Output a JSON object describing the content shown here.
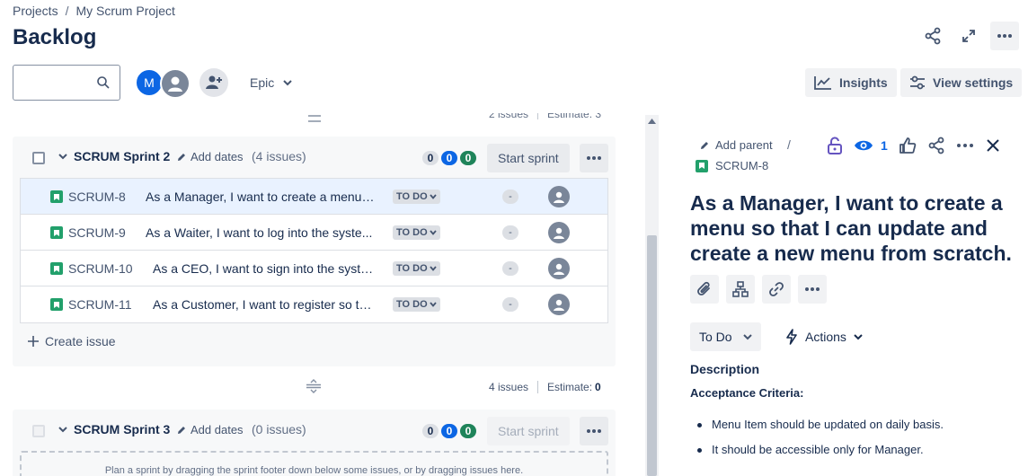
{
  "breadcrumb": {
    "projects": "Projects",
    "separator": "/",
    "project": "My Scrum Project"
  },
  "page": {
    "title": "Backlog"
  },
  "toolbar": {
    "search_value": "",
    "avatar_initial": "M",
    "epic_filter": "Epic",
    "insights_label": "Insights",
    "view_settings_label": "View settings"
  },
  "faded_summary": {
    "issues": "2 issues",
    "estimate": "Estimate: 3"
  },
  "sprint2": {
    "name": "SCRUM Sprint 2",
    "add_dates": "Add dates",
    "issue_count": "(4 issues)",
    "pills": [
      "0",
      "0",
      "0"
    ],
    "start_label": "Start sprint",
    "issues": [
      {
        "key": "SCRUM-8",
        "summary": "As a Manager, I want to create a menu ...",
        "status": "TO DO",
        "estimate": "-"
      },
      {
        "key": "SCRUM-9",
        "summary": "As a Waiter, I want to log into the syste...",
        "status": "TO DO",
        "estimate": "-"
      },
      {
        "key": "SCRUM-10",
        "summary": "As a CEO, I want to sign into the syste...",
        "status": "TO DO",
        "estimate": "-"
      },
      {
        "key": "SCRUM-11",
        "summary": "As a Customer, I want to register so th...",
        "status": "TO DO",
        "estimate": "-"
      }
    ],
    "create_issue": "Create issue",
    "summary_issues": "4 issues",
    "summary_estimate_label": "Estimate:",
    "summary_estimate_value": "0"
  },
  "sprint3": {
    "name": "SCRUM Sprint 3",
    "add_dates": "Add dates",
    "issue_count": "(0 issues)",
    "pills": [
      "0",
      "0",
      "0"
    ],
    "start_label": "Start sprint",
    "empty_text": "Plan a sprint by dragging the sprint footer down below some issues, or by dragging issues here."
  },
  "detail": {
    "add_parent": "Add parent",
    "separator": "/",
    "key": "SCRUM-8",
    "watch_count": "1",
    "title": "As a Manager, I want to create a menu so that I can update and create a new menu from scratch.",
    "status": "To Do",
    "actions": "Actions",
    "description_label": "Description",
    "criteria_label": "Acceptance Criteria:",
    "criteria": [
      "Menu Item should be updated on daily basis.",
      "It should be accessible only for Manager."
    ]
  },
  "colors": {
    "accent": "#0c66e4",
    "story": "#22a06b",
    "done_green": "#1f845a",
    "selected_row": "#e9f2ff"
  }
}
